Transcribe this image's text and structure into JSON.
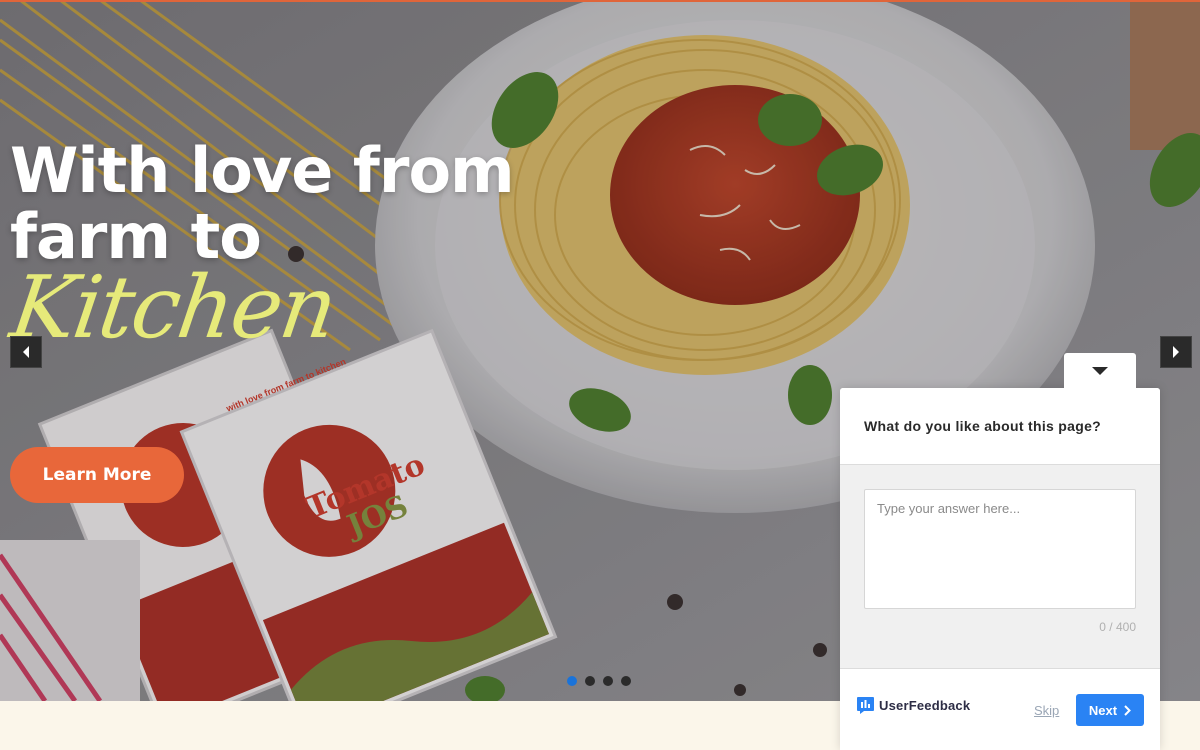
{
  "hero": {
    "title_line1": "With love from",
    "title_line2": "farm to",
    "script_word": "Kitchen",
    "cta_label": "Learn More",
    "packet_brand_1": "Tomato",
    "packet_brand_2": "JOS",
    "packet_tagline": "with love from farm to kitchen",
    "slides": {
      "count": 4,
      "active_index": 0
    }
  },
  "colors": {
    "accent": "#e8673a",
    "script_yellow": "#e6ea7a",
    "dot_active": "#1a73d9",
    "button_blue": "#2a83f4"
  },
  "feedback": {
    "question": "What do you like about this page?",
    "answer_value": "",
    "answer_placeholder": "Type your answer here...",
    "counter": "0 / 400",
    "brand": "UserFeedback",
    "skip_label": "Skip",
    "next_label": "Next"
  },
  "icons": {
    "prev": "caret-left-icon",
    "next": "caret-right-icon",
    "collapse": "chevron-down-icon",
    "brand": "userfeedback-logo-icon",
    "next_arrow": "chevron-right-icon"
  }
}
